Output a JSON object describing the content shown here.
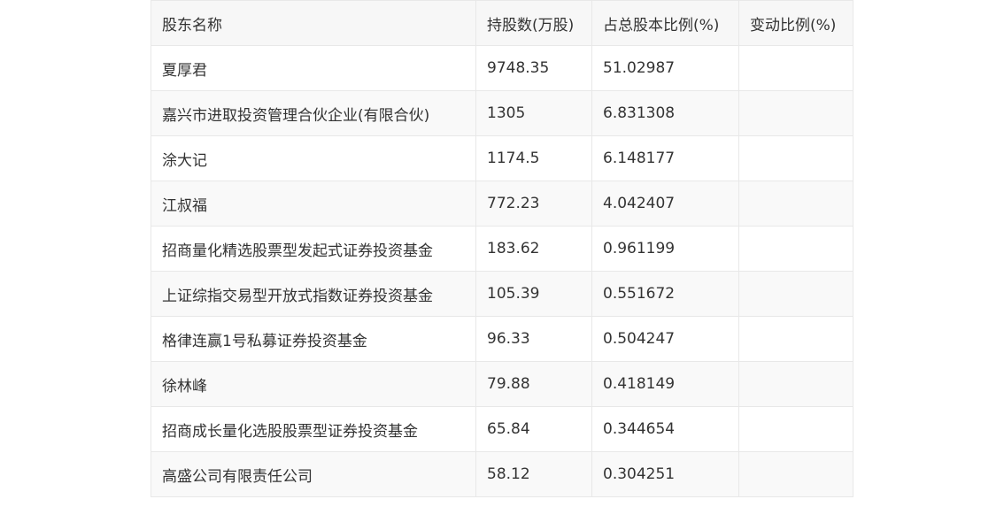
{
  "table": {
    "headers": [
      "股东名称",
      "持股数(万股)",
      "占总股本比例(%)",
      "变动比例(%)"
    ],
    "rows": [
      [
        "夏厚君",
        "9748.35",
        "51.02987",
        ""
      ],
      [
        "嘉兴市进取投资管理合伙企业(有限合伙)",
        "1305",
        "6.831308",
        ""
      ],
      [
        "涂大记",
        "1174.5",
        "6.148177",
        ""
      ],
      [
        "江叔福",
        "772.23",
        "4.042407",
        ""
      ],
      [
        "招商量化精选股票型发起式证券投资基金",
        "183.62",
        "0.961199",
        ""
      ],
      [
        "上证综指交易型开放式指数证券投资基金",
        "105.39",
        "0.551672",
        ""
      ],
      [
        "格律连赢1号私募证券投资基金",
        "96.33",
        "0.504247",
        ""
      ],
      [
        "徐林峰",
        "79.88",
        "0.418149",
        ""
      ],
      [
        "招商成长量化选股股票型证券投资基金",
        "65.84",
        "0.344654",
        ""
      ],
      [
        "高盛公司有限责任公司",
        "58.12",
        "0.304251",
        ""
      ]
    ]
  }
}
